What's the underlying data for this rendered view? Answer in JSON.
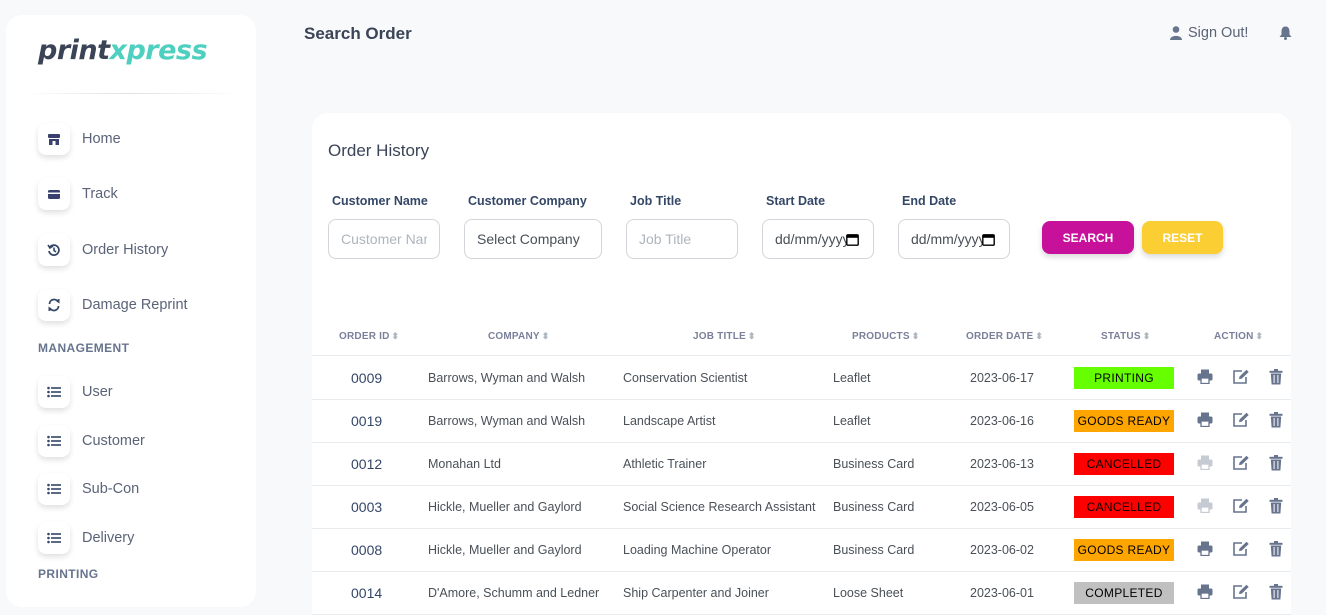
{
  "brand": {
    "part1": "print",
    "part2": "xpress"
  },
  "sidebar": {
    "items": [
      {
        "label": "Home",
        "icon": "shop-icon"
      },
      {
        "label": "Track",
        "icon": "credit-card-icon"
      },
      {
        "label": "Order History",
        "icon": "history-icon"
      },
      {
        "label": "Damage Reprint",
        "icon": "sync-icon"
      }
    ],
    "management_title": "MANAGEMENT",
    "management_items": [
      {
        "label": "User",
        "icon": "list-icon"
      },
      {
        "label": "Customer",
        "icon": "list-icon"
      },
      {
        "label": "Sub-Con",
        "icon": "list-icon"
      },
      {
        "label": "Delivery",
        "icon": "list-icon"
      }
    ],
    "printing_title": "PRINTING"
  },
  "header": {
    "title": "Search Order",
    "signout": "Sign Out!"
  },
  "card": {
    "title": "Order History"
  },
  "filters": {
    "customer_name_label": "Customer Name",
    "customer_name_placeholder": "Customer Name",
    "company_label": "Customer Company",
    "company_value": "Select Company",
    "job_title_label": "Job Title",
    "job_title_placeholder": "Job Title",
    "start_label": "Start Date",
    "start_value": "dd/mm/yyyy",
    "end_label": "End Date",
    "end_value": "dd/mm/yyyy",
    "search_button": "SEARCH",
    "reset_button": "RESET"
  },
  "table": {
    "headers": [
      "ORDER ID",
      "COMPANY",
      "JOB TITLE",
      "PRODUCTS",
      "ORDER DATE",
      "STATUS",
      "ACTION"
    ],
    "rows": [
      {
        "id": "0009",
        "company": "Barrows, Wyman and Walsh",
        "job": "Conservation Scientist",
        "product": "Leaflet",
        "date": "2023-06-17",
        "status": "PRINTING",
        "color": "#66ff00",
        "print_enabled": true
      },
      {
        "id": "0019",
        "company": "Barrows, Wyman and Walsh",
        "job": "Landscape Artist",
        "product": "Leaflet",
        "date": "2023-06-16",
        "status": "GOODS READY",
        "color": "#ffa500",
        "print_enabled": true
      },
      {
        "id": "0012",
        "company": "Monahan Ltd",
        "job": "Athletic Trainer",
        "product": "Business Card",
        "date": "2023-06-13",
        "status": "CANCELLED",
        "color": "#ff0000",
        "print_enabled": false
      },
      {
        "id": "0003",
        "company": "Hickle, Mueller and Gaylord",
        "job": "Social Science Research Assistant",
        "product": "Business Card",
        "date": "2023-06-05",
        "status": "CANCELLED",
        "color": "#ff0000",
        "print_enabled": false
      },
      {
        "id": "0008",
        "company": "Hickle, Mueller and Gaylord",
        "job": "Loading Machine Operator",
        "product": "Business Card",
        "date": "2023-06-02",
        "status": "GOODS READY",
        "color": "#ffa500",
        "print_enabled": true
      },
      {
        "id": "0014",
        "company": "D'Amore, Schumm and Ledner",
        "job": "Ship Carpenter and Joiner",
        "product": "Loose Sheet",
        "date": "2023-06-01",
        "status": "COMPLETED",
        "color": "#c0c0c0",
        "print_enabled": true
      }
    ]
  }
}
